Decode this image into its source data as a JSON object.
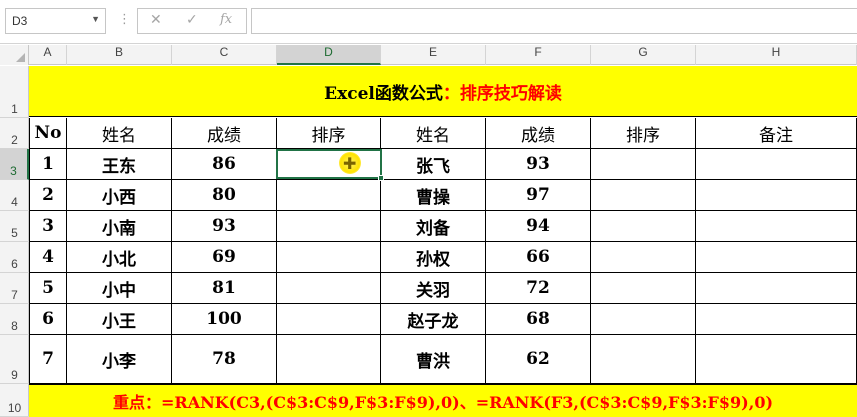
{
  "formula_bar": {
    "name_box": "D3",
    "dots": "⋮",
    "cancel_glyph": "✕",
    "enter_glyph": "✓",
    "fx_glyph": "fx",
    "formula": ""
  },
  "sheet": {
    "columns": [
      "A",
      "B",
      "C",
      "D",
      "E",
      "F",
      "G",
      "H"
    ],
    "rows": [
      "1",
      "2",
      "3",
      "4",
      "5",
      "6",
      "7",
      "8",
      "9",
      "10"
    ],
    "selected_cell": "D3",
    "title_prefix": "Excel函数公式",
    "title_sep": "：",
    "title_main": "排序技巧解读",
    "headers": [
      "No",
      "姓名",
      "成绩",
      "排序",
      "姓名",
      "成绩",
      "排序",
      "备注"
    ],
    "data": [
      [
        "1",
        "王东",
        "86",
        "",
        "张飞",
        "93",
        "",
        ""
      ],
      [
        "2",
        "小西",
        "80",
        "",
        "曹操",
        "97",
        "",
        ""
      ],
      [
        "3",
        "小南",
        "93",
        "",
        "刘备",
        "94",
        "",
        ""
      ],
      [
        "4",
        "小北",
        "69",
        "",
        "孙权",
        "66",
        "",
        ""
      ],
      [
        "5",
        "小中",
        "81",
        "",
        "关羽",
        "72",
        "",
        ""
      ],
      [
        "6",
        "小王",
        "100",
        "",
        "赵子龙",
        "68",
        "",
        ""
      ],
      [
        "7",
        "小李",
        "78",
        "",
        "曹洪",
        "62",
        "",
        ""
      ]
    ],
    "footer_label": "重点：",
    "footer_formula": "=RANK(C3,(C$3:C$9,F$3:F$9),0)、=RANK(F3,(C$3:C$9,F$3:F$9),0)"
  },
  "colors": {
    "highlight": "#ffff00",
    "accent_red": "#ff0000",
    "selection": "#217346"
  }
}
